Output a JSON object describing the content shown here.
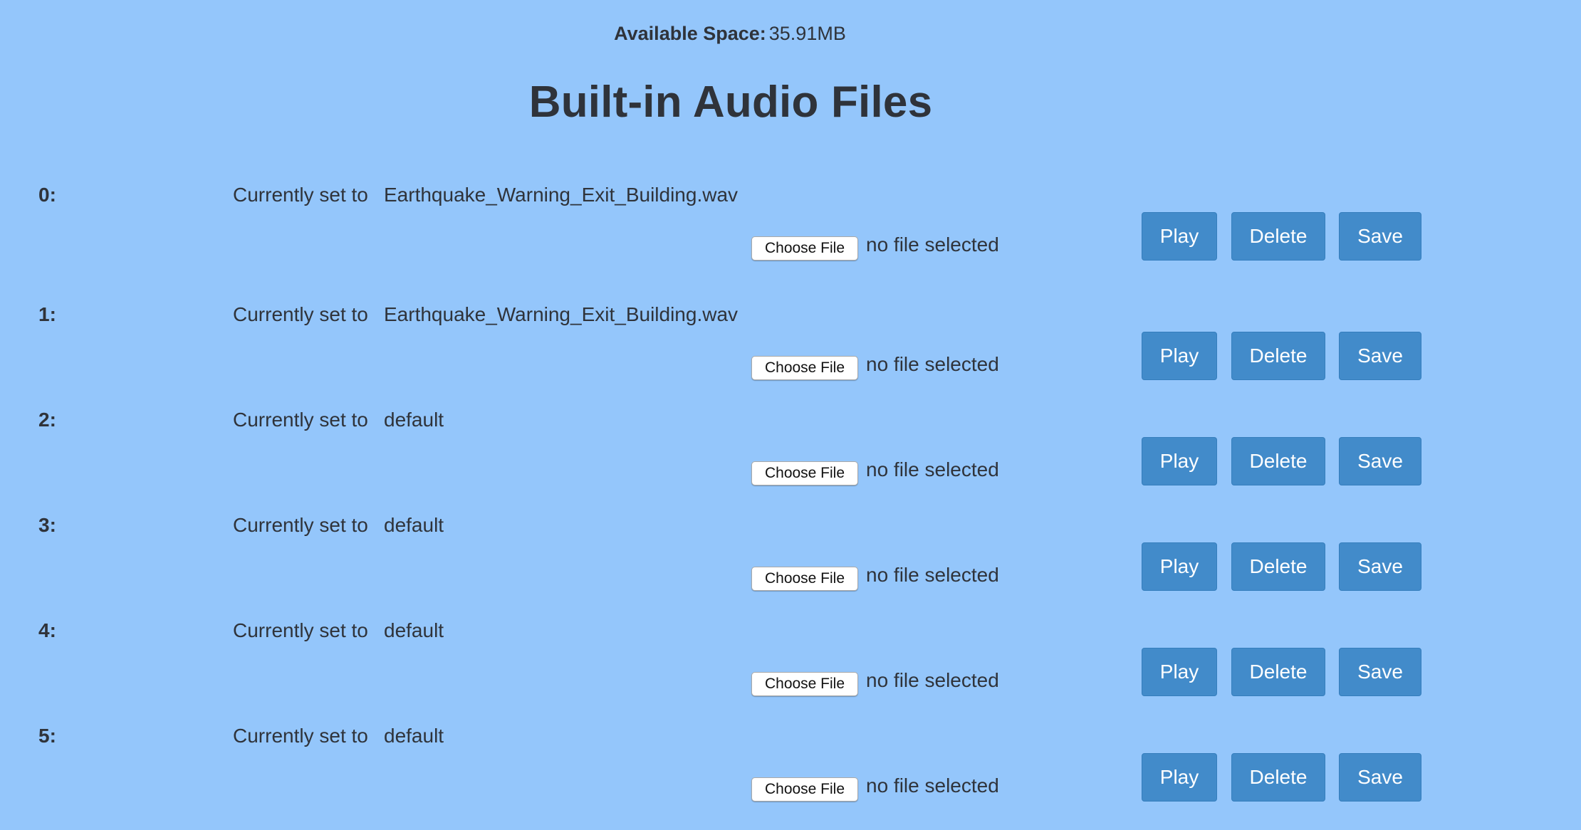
{
  "header": {
    "available_space_label": "Available Space:",
    "available_space_value": "35.91MB",
    "title": "Built-in Audio Files"
  },
  "labels": {
    "currently_set_to": "Currently set to",
    "choose_file": "Choose File",
    "no_file_selected": "no file selected",
    "play": "Play",
    "delete": "Delete",
    "save": "Save"
  },
  "slots": [
    {
      "index": "0:",
      "current": "Earthquake_Warning_Exit_Building.wav"
    },
    {
      "index": "1:",
      "current": "Earthquake_Warning_Exit_Building.wav"
    },
    {
      "index": "2:",
      "current": "default"
    },
    {
      "index": "3:",
      "current": "default"
    },
    {
      "index": "4:",
      "current": "default"
    },
    {
      "index": "5:",
      "current": "default"
    }
  ],
  "colors": {
    "background": "#94c6fb",
    "button": "#428bca",
    "text": "#2f333a"
  }
}
